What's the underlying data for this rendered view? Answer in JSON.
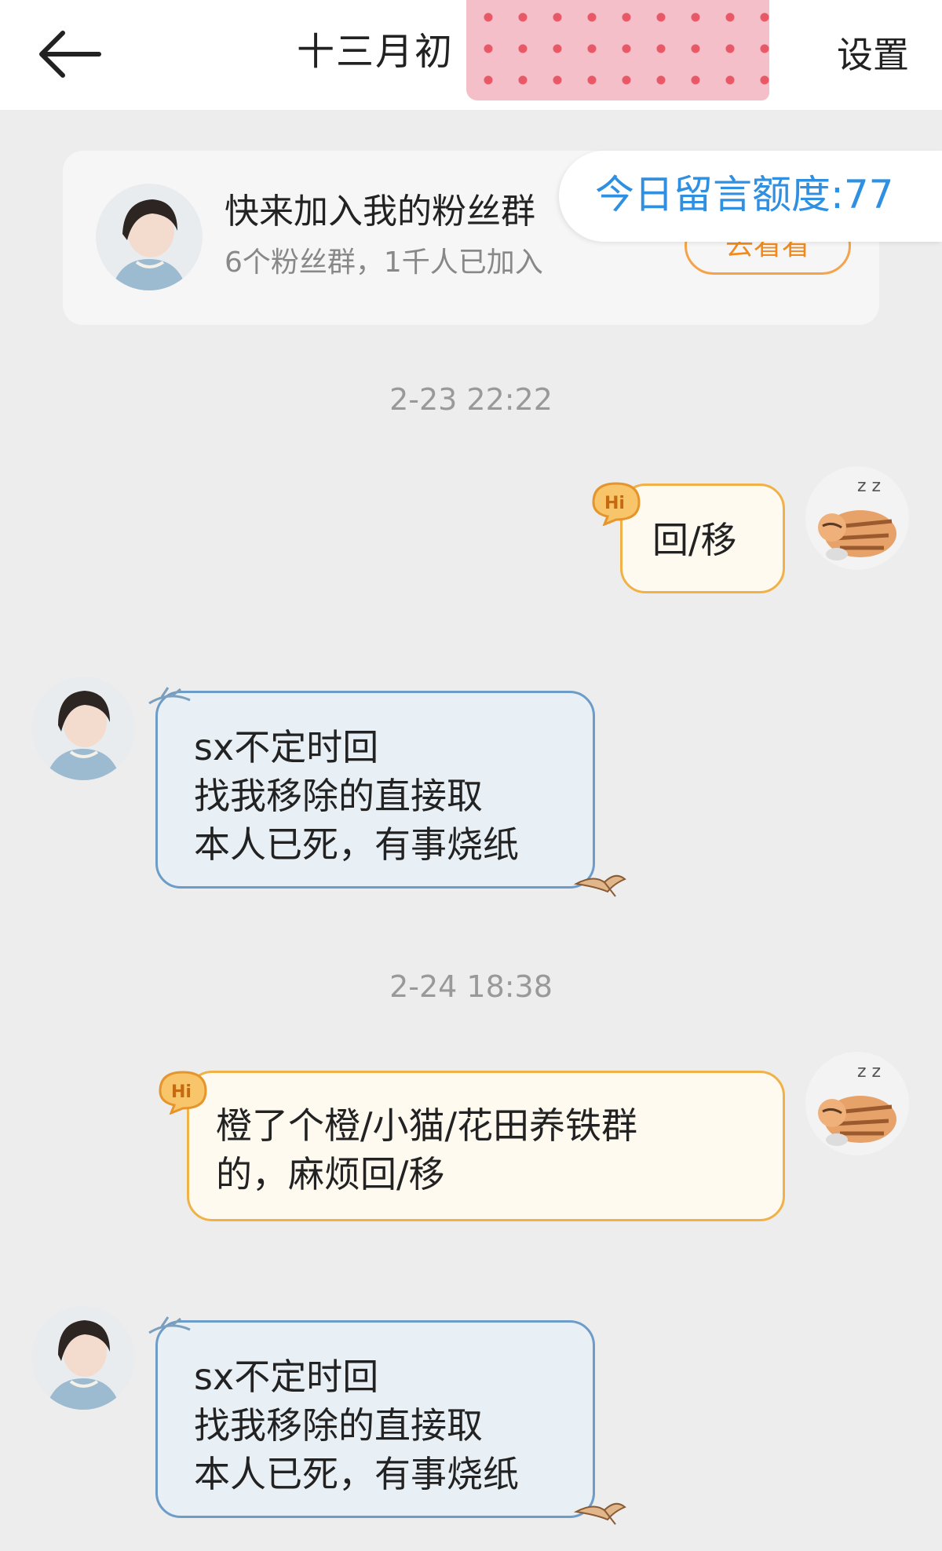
{
  "header": {
    "title": "十三月初",
    "settings_label": "设置"
  },
  "fan_card": {
    "title": "快来加入我的粉丝群",
    "subtitle": "6个粉丝群，1千人已加入",
    "join_label": "去看看"
  },
  "quota": {
    "label": "今日留言额度:77"
  },
  "messages": [
    {
      "timestamp": "2-23 22:22"
    },
    {
      "sender": "me",
      "lines": [
        "回/移"
      ]
    },
    {
      "sender": "other",
      "lines": [
        "sx不定时回",
        "找我移除的直接取",
        "本人已死，有事烧纸"
      ]
    },
    {
      "timestamp": "2-24 18:38"
    },
    {
      "sender": "me",
      "lines": [
        "橙了个橙/小猫/花田养铁群",
        "的，麻烦回/移"
      ]
    },
    {
      "sender": "other",
      "lines": [
        "sx不定时回",
        "找我移除的直接取",
        "本人已死，有事烧纸"
      ]
    }
  ],
  "colors": {
    "quota_text": "#2f8fe0",
    "out_bubble_border": "#f0b148",
    "in_bubble_border": "#6d9cc8",
    "badge": "#f5a34a"
  },
  "icons": {
    "back": "arrow-left-icon",
    "hi": "hi-badge-icon"
  }
}
